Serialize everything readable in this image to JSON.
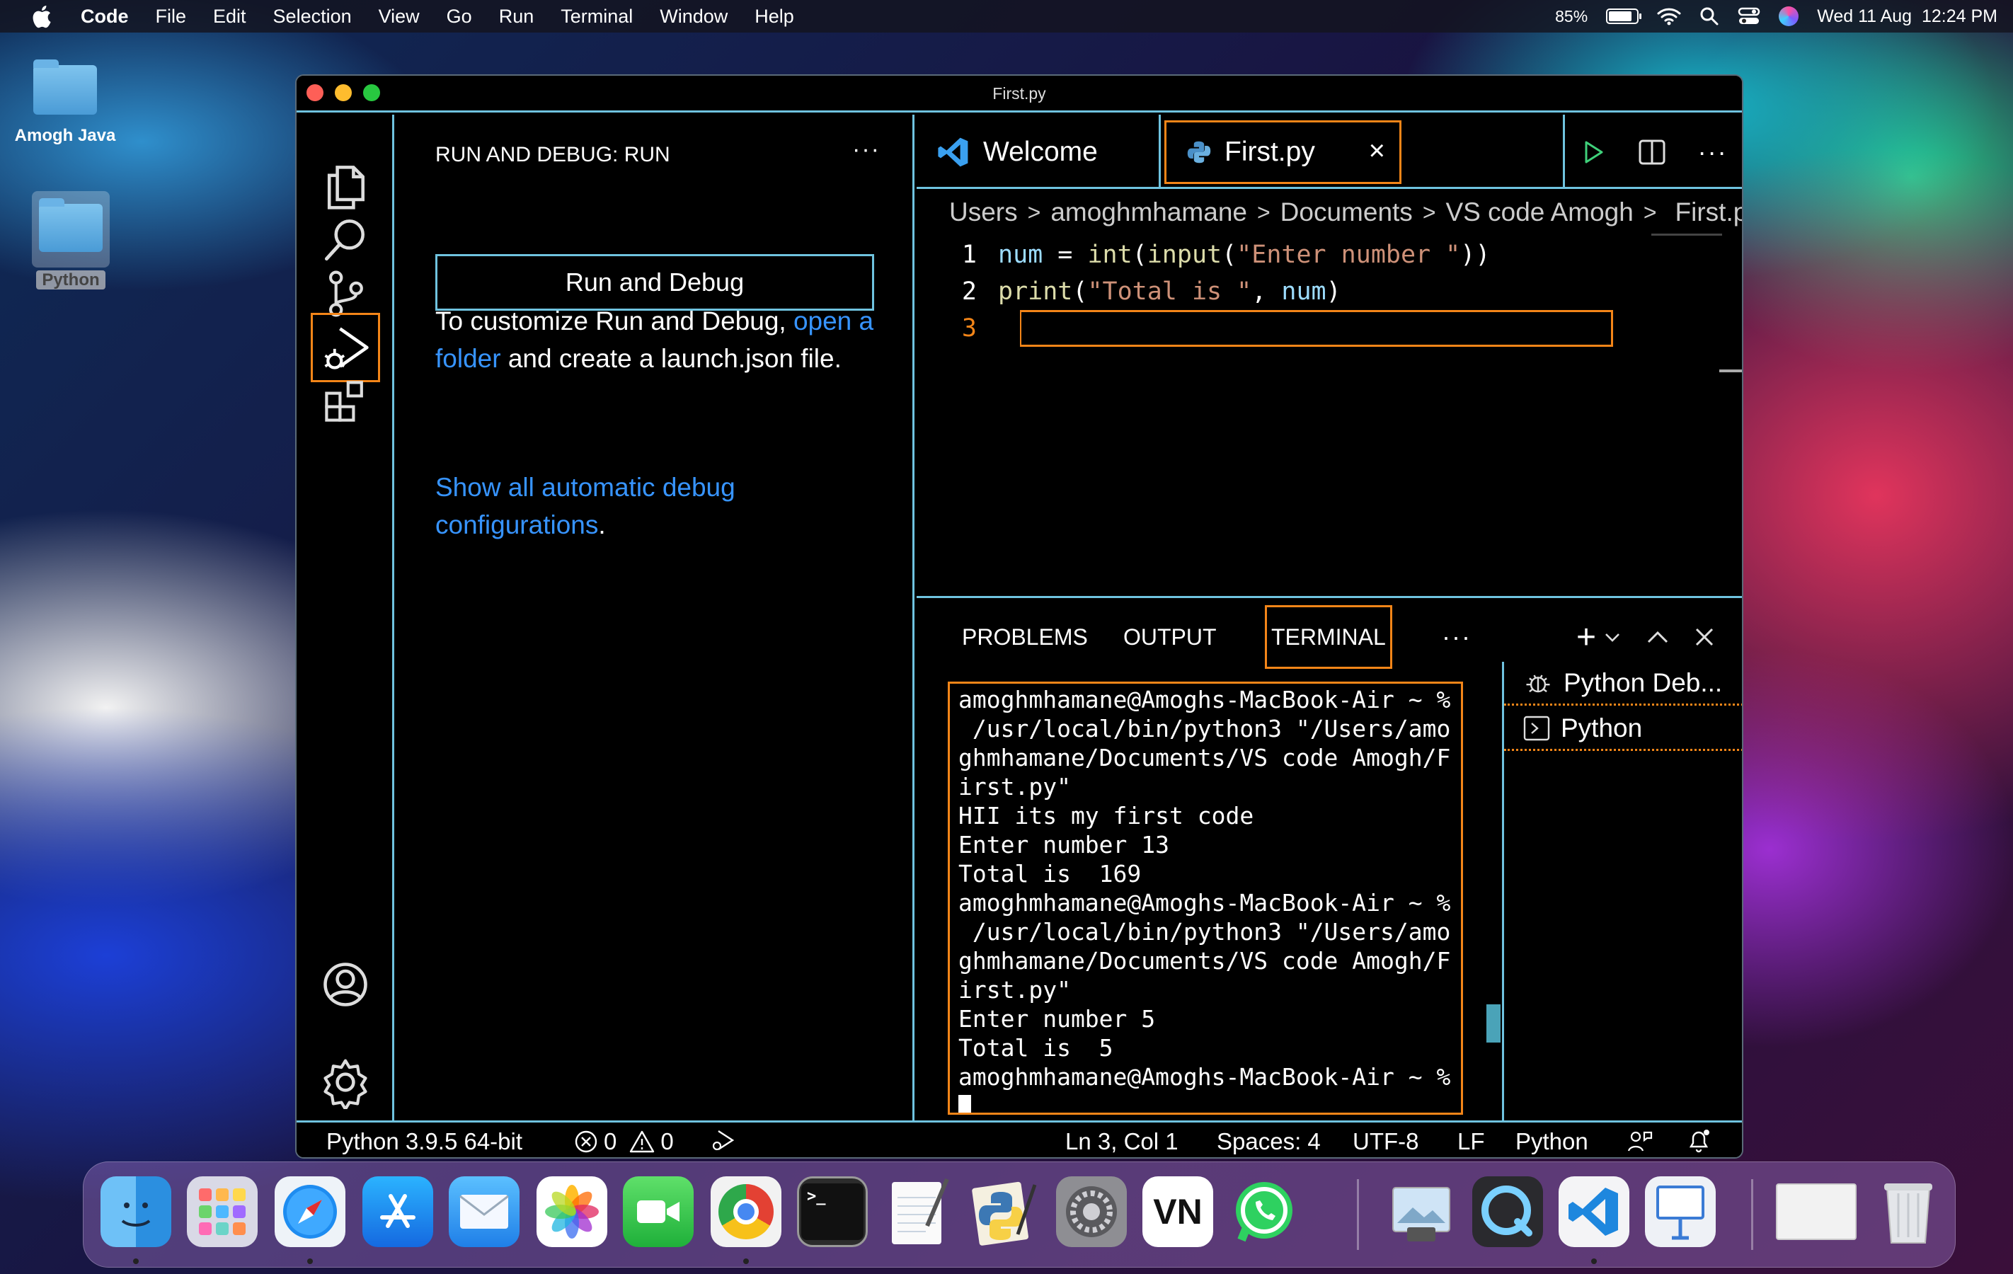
{
  "menubar": {
    "app": "Code",
    "items": [
      "File",
      "Edit",
      "Selection",
      "View",
      "Go",
      "Run",
      "Terminal",
      "Window",
      "Help"
    ],
    "battery": "85%",
    "battery_level": 0.85,
    "datetime": "Wed 11 Aug  12:24 PM"
  },
  "desktop": {
    "icons": [
      {
        "label": "Amogh Java",
        "icon": "folder-icon"
      },
      {
        "label": "Python",
        "icon": "folder-icon"
      }
    ]
  },
  "window": {
    "title": "First.py",
    "activity_bar": [
      "explorer-icon",
      "search-icon",
      "source-control-icon",
      "run-debug-icon",
      "extensions-icon",
      "account-icon",
      "settings-gear-icon"
    ],
    "sidebar": {
      "title": "RUN AND DEBUG: RUN",
      "more": "···",
      "run_button": "Run and Debug",
      "customize_text_1": "To customize Run and Debug,",
      "customize_link": "open a folder",
      "customize_text_2": "and create a launch.json file.",
      "show_link": "Show all automatic debug configurations",
      "show_tail": "."
    },
    "editor": {
      "tabs": [
        {
          "label": "Welcome",
          "icon": "vscode-logo-icon"
        },
        {
          "label": "First.py",
          "icon": "python-file-icon",
          "close": "×"
        }
      ],
      "breadcrumb": [
        "Users",
        "amoghmhamane",
        "Documents",
        "VS code Amogh",
        "First.py"
      ],
      "lines": [
        {
          "num": "1",
          "code": "num = int(input(\"Enter number \"))"
        },
        {
          "num": "2",
          "code": "print(\"Total is \", num)"
        },
        {
          "num": "3",
          "code": ""
        }
      ]
    },
    "panel": {
      "tabs": [
        "PROBLEMS",
        "OUTPUT",
        "TERMINAL"
      ],
      "active_tab": "TERMINAL",
      "more": "···",
      "terminal_lines": [
        "amoghmhamane@Amoghs-MacBook-Air ~ %",
        " /usr/local/bin/python3 \"/Users/amo",
        "ghmhamane/Documents/VS code Amogh/F",
        "irst.py\"",
        "HII its my first code",
        "Enter number 13",
        "Total is  169",
        "amoghmhamane@Amoghs-MacBook-Air ~ %",
        " /usr/local/bin/python3 \"/Users/amo",
        "ghmhamane/Documents/VS code Amogh/F",
        "irst.py\"",
        "Enter number 5",
        "Total is  5",
        "amoghmhamane@Amoghs-MacBook-Air ~ %"
      ],
      "terminal_list": [
        "Python Deb...",
        "Python"
      ]
    },
    "statusbar": {
      "interpreter": "Python 3.9.5 64-bit",
      "errors": "0",
      "warnings": "0",
      "position": "Ln 3, Col 1",
      "spaces": "Spaces: 4",
      "encoding": "UTF-8",
      "eol": "LF",
      "language": "Python"
    }
  },
  "dock": {
    "apps": [
      "Finder",
      "Launchpad",
      "Safari",
      "App Store",
      "Mail",
      "Photos",
      "FaceTime",
      "Chrome",
      "Terminal",
      "TextEdit",
      "Python Launcher",
      "System Preferences",
      "VN",
      "WhatsApp",
      "Preview",
      "QuickTime",
      "VS Code",
      "Keynote",
      "Screenshot",
      "Trash"
    ],
    "vn_label": "VN",
    "terminal_label": ">_"
  },
  "colors": {
    "accent_border": "#6fc3df",
    "focus_orange": "#f38518",
    "link_blue": "#3794ff"
  }
}
